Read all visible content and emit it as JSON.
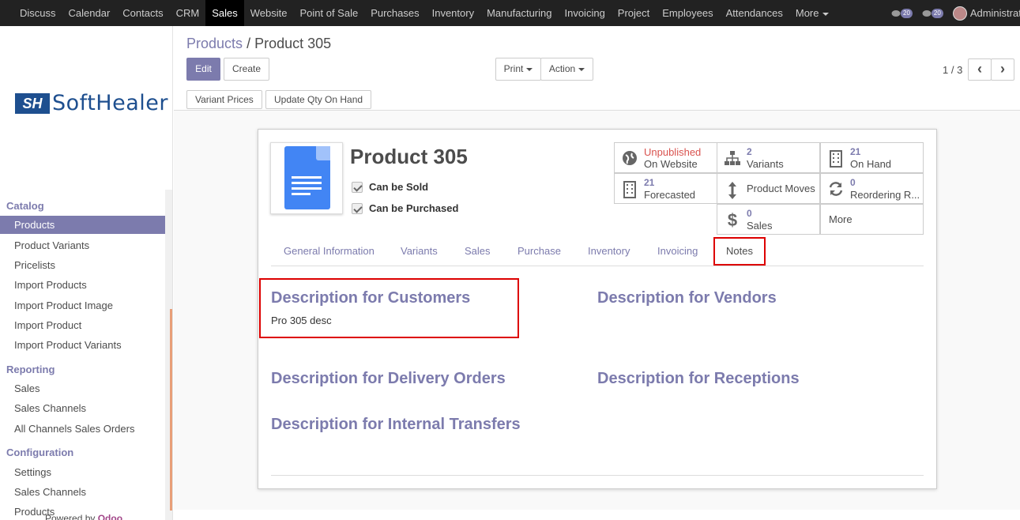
{
  "topnav": {
    "items": [
      "Discuss",
      "Calendar",
      "Contacts",
      "CRM",
      "Sales",
      "Website",
      "Point of Sale",
      "Purchases",
      "Inventory",
      "Manufacturing",
      "Invoicing",
      "Project",
      "Employees",
      "Attendances",
      "More"
    ],
    "active": "Sales",
    "badge_messages": "20",
    "badge_activities": "20",
    "user": "Administrator"
  },
  "sidebar": {
    "logo_mark": "SH",
    "logo_text": "SoftHealer",
    "sections": [
      {
        "title": "Catalog",
        "items": [
          "Products",
          "Product Variants",
          "Pricelists",
          "Import Products",
          "Import Product Image",
          "Import Product",
          "Import Product Variants"
        ]
      },
      {
        "title": "Reporting",
        "items": [
          "Sales",
          "Sales Channels",
          "All Channels Sales Orders"
        ]
      },
      {
        "title": "Configuration",
        "items": [
          "Settings",
          "Sales Channels",
          "Products"
        ]
      }
    ],
    "active_item": "Products",
    "powered_by": "Powered by",
    "powered_brand": "Odoo"
  },
  "breadcrumb": {
    "parent": "Products",
    "separator": "/",
    "current": "Product 305"
  },
  "buttons": {
    "edit": "Edit",
    "create": "Create",
    "print": "Print",
    "action": "Action",
    "variant_prices": "Variant Prices",
    "update_qty": "Update Qty On Hand"
  },
  "pager": {
    "value": "1 / 3",
    "prev": "‹",
    "next": "›"
  },
  "product": {
    "name": "Product 305",
    "can_be_sold": "Can be Sold",
    "can_be_purchased": "Can be Purchased"
  },
  "smart_buttons": {
    "website_state": "Unpublished",
    "website_label": "On Website",
    "variants_num": "2",
    "variants_label": "Variants",
    "onhand_num": "21",
    "onhand_label": "On Hand",
    "forecast_num": "21",
    "forecast_label": "Forecasted",
    "moves_label": "Product Moves",
    "reorder_num": "0",
    "reorder_label": "Reordering R...",
    "sales_num": "0",
    "sales_label": "Sales",
    "more_label": "More"
  },
  "tabs": [
    "General Information",
    "Variants",
    "Sales",
    "Purchase",
    "Inventory",
    "Invoicing",
    "Notes"
  ],
  "active_tab": "Notes",
  "notes": {
    "customers_title": "Description for Customers",
    "customers_text": "Pro 305 desc",
    "vendors_title": "Description for Vendors",
    "delivery_title": "Description for Delivery Orders",
    "receptions_title": "Description for Receptions",
    "internal_title": "Description for Internal Transfers"
  },
  "colors": {
    "accent": "#7c7bad",
    "topbar": "#222222",
    "highlight": "#dd0000",
    "unpublished": "#d9534f"
  }
}
